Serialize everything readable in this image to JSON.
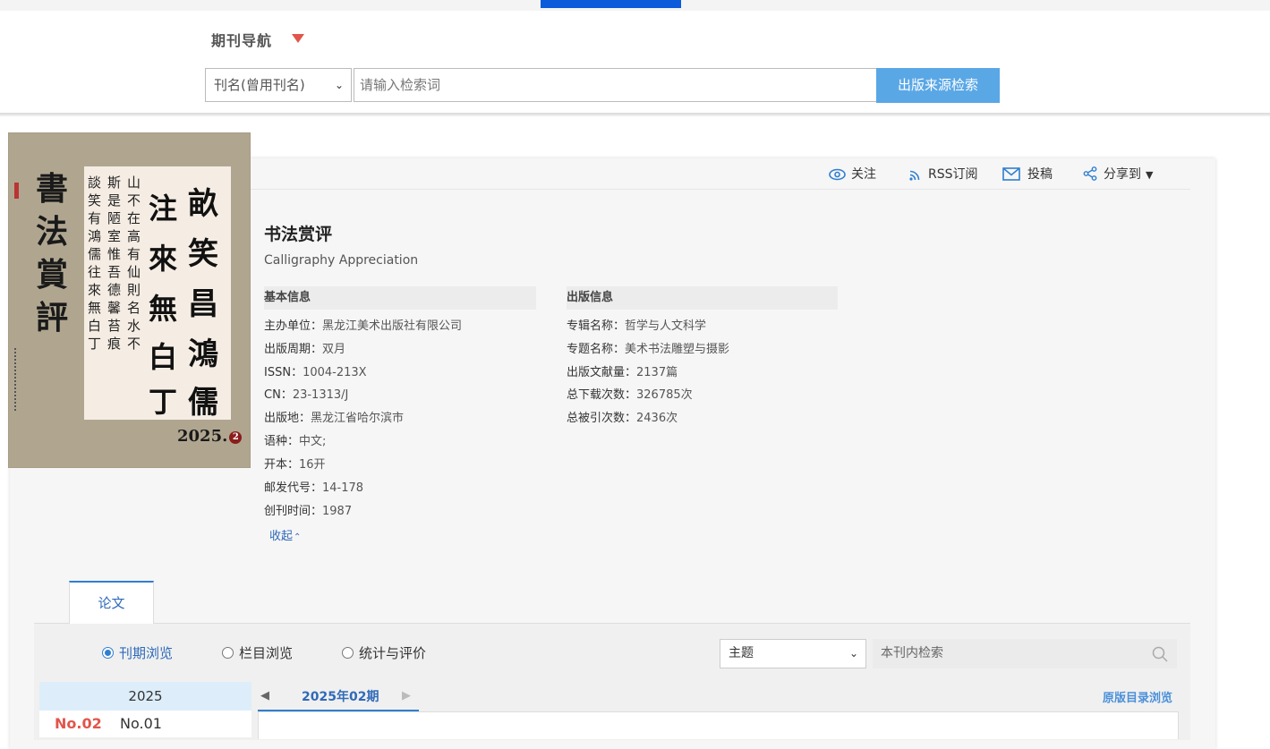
{
  "nav": {
    "title": "期刊导航",
    "select_value": "刊名(曾用刊名)",
    "search_placeholder": "请输入检索词",
    "search_button": "出版来源检索"
  },
  "actions": {
    "follow": "关注",
    "rss": "RSS订阅",
    "submit": "投稿",
    "share": "分享到"
  },
  "cover": {
    "title_chars": [
      "書",
      "法",
      "賞",
      "評"
    ],
    "issue": "2025.",
    "issue_num": "2",
    "big_chars": [
      "畝",
      "笑",
      "昌",
      "鴻",
      "儒",
      "注",
      "來",
      "無",
      "白",
      "丁"
    ],
    "small_cols": [
      "山不在高有仙則名水不",
      "斯是陋室惟吾德馨苔痕",
      "談笑有鴻儒往來無白丁"
    ]
  },
  "journal": {
    "title": "书法赏评",
    "english_title": "Calligraphy Appreciation",
    "basic_head": "基本信息",
    "basic": [
      {
        "k": "主办单位：",
        "v": "黑龙江美术出版社有限公司"
      },
      {
        "k": "出版周期：",
        "v": "双月"
      },
      {
        "k": "ISSN：",
        "v": "1004-213X"
      },
      {
        "k": "CN：",
        "v": "23-1313/J"
      },
      {
        "k": "出版地：",
        "v": "黑龙江省哈尔滨市"
      },
      {
        "k": "语种：",
        "v": "中文;"
      },
      {
        "k": "开本：",
        "v": "16开"
      },
      {
        "k": "邮发代号：",
        "v": "14-178"
      },
      {
        "k": "创刊时间：",
        "v": "1987"
      }
    ],
    "pub_head": "出版信息",
    "pub": [
      {
        "k": "专辑名称：",
        "v": "哲学与人文科学"
      },
      {
        "k": "专题名称：",
        "v": "美术书法雕塑与摄影"
      },
      {
        "k": "出版文献量：",
        "v": "2137篇"
      },
      {
        "k": "总下载次数：",
        "v": "326785次"
      },
      {
        "k": "总被引次数：",
        "v": "2436次"
      }
    ],
    "collapse": "收起"
  },
  "tabs": {
    "papers": "论文"
  },
  "browse": {
    "options": [
      "刊期浏览",
      "栏目浏览",
      "统计与评价"
    ],
    "selected": "刊期浏览",
    "field_select": "主题",
    "inner_search_placeholder": "本刊内检索",
    "year": "2025",
    "issues": [
      "No.02",
      "No.01"
    ],
    "current_period": "2025年02期",
    "original_toc_link": "原版目录浏览"
  },
  "colors": {
    "accent": "#2f7fd0",
    "search_button": "#5aa7e6",
    "active_issue": "#e2554a",
    "top_active_bar": "#0b5bdb"
  }
}
